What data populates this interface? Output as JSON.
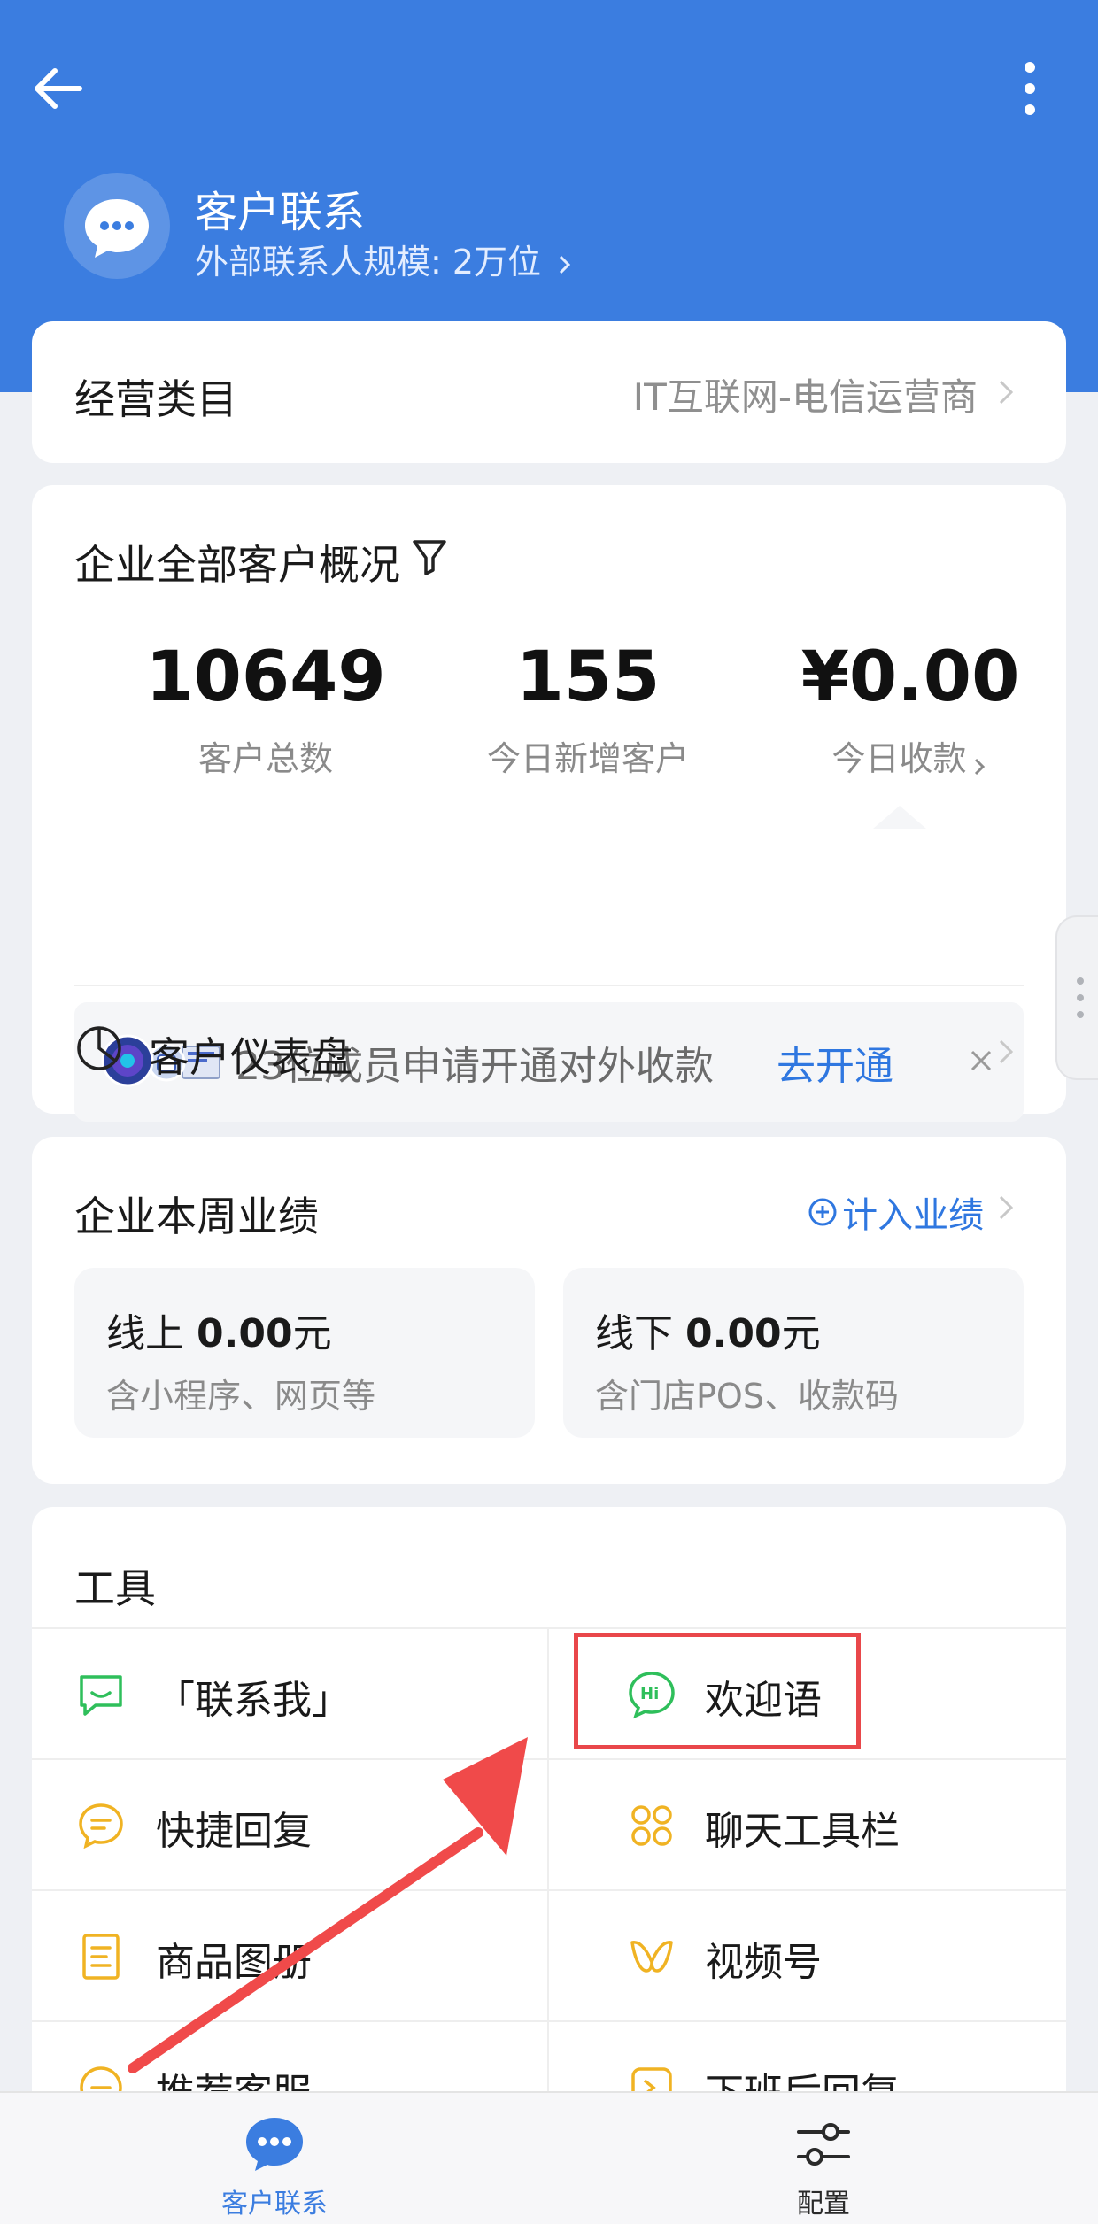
{
  "header": {
    "title": "客户联系",
    "subtitle": "外部联系人规模: 2万位",
    "back_icon": "arrow-left-icon",
    "more_icon": "more-vertical-icon",
    "avatar_icon": "chat-bubble-icon"
  },
  "business_category": {
    "label": "经营类目",
    "value": "IT互联网-电信运营商"
  },
  "overview": {
    "title": "企业全部客户概况",
    "filter_icon": "filter-icon",
    "stats": [
      {
        "value": "10649",
        "label": "客户总数"
      },
      {
        "value": "155",
        "label": "今日新增客户"
      },
      {
        "value": "¥0.00",
        "label": "今日收款"
      }
    ],
    "notice": {
      "text": "23位成员申请开通对外收款",
      "action": "去开通",
      "close_icon": "close-icon"
    },
    "dashboard": {
      "label": "客户仪表盘",
      "icon": "pie-chart-icon"
    }
  },
  "performance": {
    "title": "企业本周业绩",
    "action": "计入业绩",
    "online": {
      "prefix": "线上 ",
      "amount": "0.00",
      "unit": "元",
      "desc": "含小程序、网页等"
    },
    "offline": {
      "prefix": "线下 ",
      "amount": "0.00",
      "unit": "元",
      "desc": "含门店POS、收款码"
    }
  },
  "tools": {
    "title": "工具",
    "items": [
      {
        "label": "「联系我」",
        "icon": "contact-me-icon"
      },
      {
        "label": "欢迎语",
        "icon": "hi-bubble-icon"
      },
      {
        "label": "快捷回复",
        "icon": "quick-reply-icon"
      },
      {
        "label": "聊天工具栏",
        "icon": "chat-toolbar-icon"
      },
      {
        "label": "商品图册",
        "icon": "product-album-icon"
      },
      {
        "label": "视频号",
        "icon": "channels-icon"
      },
      {
        "label": "推荐客服",
        "icon": "recommend-service-icon"
      },
      {
        "label": "下班后回复",
        "icon": "after-work-reply-icon"
      }
    ]
  },
  "bottom_nav": [
    {
      "label": "客户联系",
      "icon": "chat-bubble-icon",
      "active": true
    },
    {
      "label": "配置",
      "icon": "sliders-icon",
      "active": false
    }
  ],
  "colors": {
    "brand_blue": "#3b7de0",
    "link_blue": "#2f77e0",
    "green": "#2fbf5b",
    "yellow": "#f0b323",
    "highlight_red": "#e9474a"
  }
}
